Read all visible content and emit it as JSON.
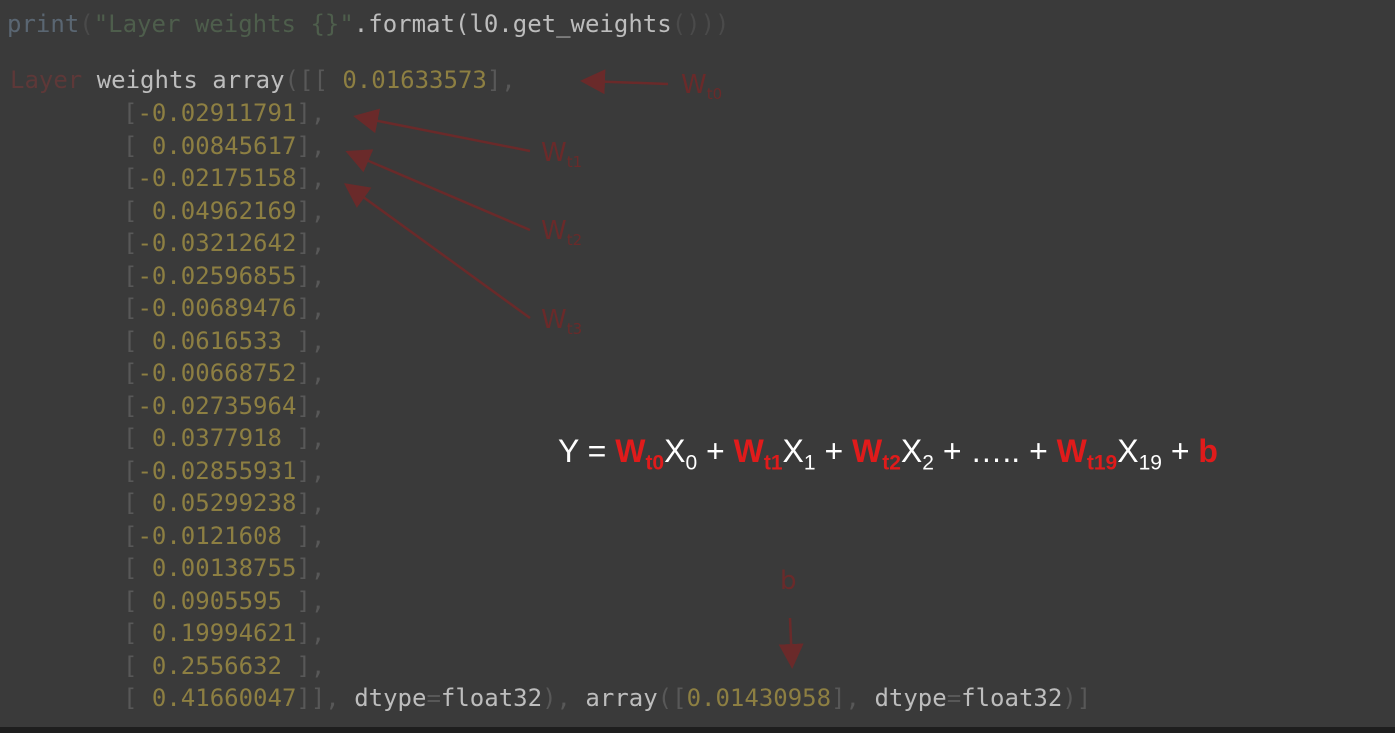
{
  "code": {
    "kw": "print",
    "paren_open": "(",
    "string": "\"Layer weights {}\"",
    "method": ".format(l0.get_weights",
    "paren_close": "()))"
  },
  "output": {
    "prefix_word": "Layer",
    "prefix_rest": " weights ",
    "array_kw": "array",
    "open_brackets": "([[ ",
    "first_value": "0.01633573",
    "first_close": "],",
    "rows": [
      "-0.02911791",
      " 0.00845617",
      "-0.02175158",
      " 0.04962169",
      "-0.03212642",
      "-0.02596855",
      "-0.00689476",
      " 0.0616533 ",
      "-0.00668752",
      "-0.02735964",
      " 0.0377918 ",
      "-0.02855931",
      " 0.05299238",
      "-0.0121608 ",
      " 0.00138755",
      " 0.0905595 ",
      " 0.19994621",
      " 0.2556632 "
    ],
    "row_close": "],",
    "last_value": " 0.41660047",
    "last_close": "]], ",
    "dtype_kw": "dtype",
    "dtype_eq": "=",
    "dtype_val": "float32",
    "after_dtype": "), ",
    "bias_array_kw": "array",
    "bias_open": "([",
    "bias_value": "0.01430958",
    "bias_close": "], ",
    "end": ")]"
  },
  "annotations": {
    "w_letter": "W",
    "labels": [
      "t0",
      "t1",
      "t2",
      "t3"
    ],
    "bias_label": "b"
  },
  "equation": {
    "lhs": "Y = ",
    "w": "W",
    "x": "X",
    "plus": " + ",
    "ellipsis": "….. ",
    "terms": [
      {
        "w_sub": "t0",
        "x_sub": "0"
      },
      {
        "w_sub": "t1",
        "x_sub": "1"
      },
      {
        "w_sub": "t2",
        "x_sub": "2"
      },
      {
        "w_sub": "t19",
        "x_sub": "19"
      }
    ],
    "b": "b"
  },
  "colors": {
    "background": "#3a3a3a",
    "annotation_red": "#6a2a2a",
    "equation_red": "#e01b1b",
    "number_yellow": "#8d7f42"
  }
}
